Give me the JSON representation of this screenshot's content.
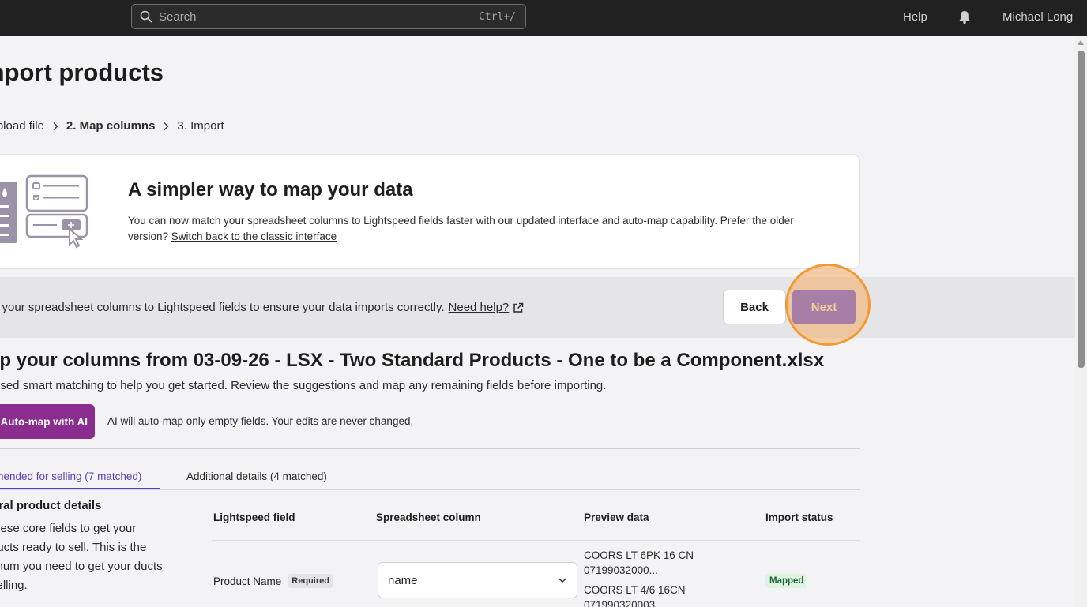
{
  "topbar": {
    "search_placeholder": "Search",
    "search_shortcut": "Ctrl+/",
    "help": "Help",
    "user": "Michael Long"
  },
  "page": {
    "title": "mport products",
    "breadcrumb": [
      "Upload file",
      "2. Map columns",
      "3. Import"
    ]
  },
  "card": {
    "title": "A simpler way to map your data",
    "text": "You can now match your spreadsheet columns to Lightspeed fields faster with our updated interface and auto-map capability. Prefer the older version?",
    "link": "Switch back to the classic interface"
  },
  "band": {
    "text": "p your spreadsheet columns to Lightspeed fields to ensure your data imports correctly.",
    "link": "Need help?",
    "back": "Back",
    "next": "Next"
  },
  "map": {
    "title": "ap your columns from 03-09-26 - LSX - Two Standard Products - One to be a Component.xlsx",
    "subtitle": "used smart matching to help you get started. Review the suggestions and map any remaining fields before importing.",
    "ai_button": "Auto-map with AI",
    "ai_note": "AI will auto-map only empty fields. Your edits are never changed."
  },
  "tabs": [
    {
      "label": "mmended for selling   (7 matched)",
      "active": true
    },
    {
      "label": "Additional details  (4 matched)",
      "active": false
    }
  ],
  "section": {
    "title": "eral product details",
    "desc": " these core fields to get your ducts ready to sell. This is the imum you need to get your ducts selling."
  },
  "table": {
    "headers": [
      "Lightspeed field",
      "Spreadsheet column",
      "Preview data",
      "Import status"
    ],
    "rows": [
      {
        "field": "Product Name",
        "badge": "Required",
        "column": "name",
        "preview": [
          "COORS LT 6PK 16 CN",
          "07199032000...",
          "COORS LT 4/6 16CN",
          "071990320003"
        ],
        "status": "Mapped"
      }
    ]
  },
  "colors": {
    "accent_purple": "#8a2d8e",
    "tab_active": "#5b3fb5",
    "next_button": "#a77ea6",
    "highlight": "#f39a35",
    "topbar": "#212121"
  }
}
